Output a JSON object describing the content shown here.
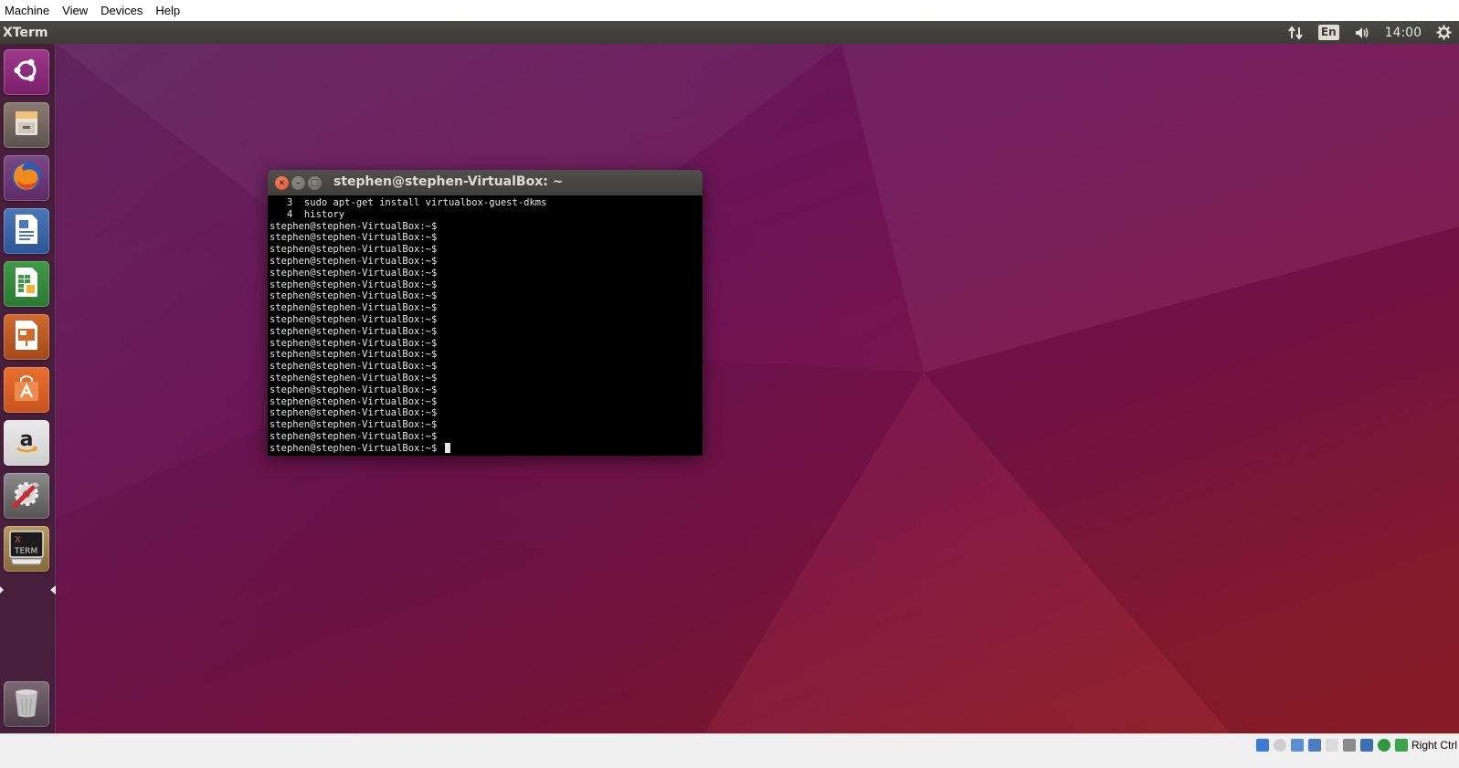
{
  "vbox_menu": [
    "Machine",
    "View",
    "Devices",
    "Help"
  ],
  "panel": {
    "app_title": "XTerm",
    "lang": "En",
    "time": "14:00"
  },
  "launcher": [
    {
      "name": "ubuntu-dash",
      "icon": "ubuntu-logo-icon"
    },
    {
      "name": "files",
      "icon": "file-cabinet-icon"
    },
    {
      "name": "firefox",
      "icon": "firefox-icon"
    },
    {
      "name": "libreoffice-writer",
      "icon": "writer-document-icon"
    },
    {
      "name": "libreoffice-calc",
      "icon": "calc-spreadsheet-icon"
    },
    {
      "name": "libreoffice-impress",
      "icon": "impress-presentation-icon"
    },
    {
      "name": "ubuntu-software",
      "icon": "shopping-bag-icon"
    },
    {
      "name": "amazon",
      "icon": "amazon-icon"
    },
    {
      "name": "system-settings",
      "icon": "wrench-gear-icon"
    },
    {
      "name": "xterm",
      "icon": "xterm-icon",
      "label": "X TERM"
    },
    {
      "name": "trash",
      "icon": "trash-icon"
    }
  ],
  "terminal": {
    "title": "stephen@stephen-VirtualBox: ~",
    "lines": [
      "   3  sudo apt-get install virtualbox-guest-dkms",
      "   4  history",
      "stephen@stephen-VirtualBox:~$",
      "stephen@stephen-VirtualBox:~$",
      "stephen@stephen-VirtualBox:~$",
      "stephen@stephen-VirtualBox:~$",
      "stephen@stephen-VirtualBox:~$",
      "stephen@stephen-VirtualBox:~$",
      "stephen@stephen-VirtualBox:~$",
      "stephen@stephen-VirtualBox:~$",
      "stephen@stephen-VirtualBox:~$",
      "stephen@stephen-VirtualBox:~$",
      "stephen@stephen-VirtualBox:~$",
      "stephen@stephen-VirtualBox:~$",
      "stephen@stephen-VirtualBox:~$",
      "stephen@stephen-VirtualBox:~$",
      "stephen@stephen-VirtualBox:~$",
      "stephen@stephen-VirtualBox:~$",
      "stephen@stephen-VirtualBox:~$",
      "stephen@stephen-VirtualBox:~$",
      "stephen@stephen-VirtualBox:~$"
    ],
    "prompt": "stephen@stephen-VirtualBox:~$ "
  },
  "status": {
    "host_key": "Right Ctrl"
  },
  "colors": {
    "accent": "#df4b16",
    "panel": "#3c3b37",
    "desktop_start": "#5e1a5a",
    "desktop_end": "#8e1d24"
  }
}
